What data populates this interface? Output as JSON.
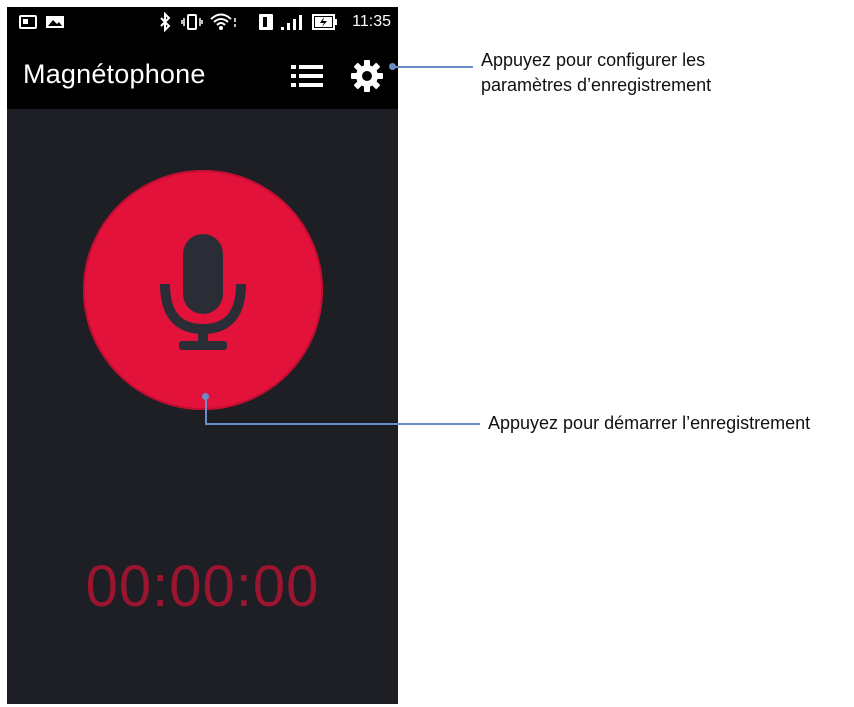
{
  "status_bar": {
    "time": "11:35",
    "icons": [
      "notification-icon",
      "image-icon",
      "bluetooth-icon",
      "vibrate-icon",
      "wifi-icon",
      "sim-icon",
      "signal-icon",
      "battery-charging-icon"
    ]
  },
  "app_bar": {
    "title": "Magnétophone",
    "icons": [
      "list-icon",
      "gear-icon"
    ]
  },
  "recorder": {
    "timer": "00:00:00",
    "record_icon": "microphone-icon"
  },
  "callouts": {
    "settings": {
      "line1": "Appuyez pour configurer les",
      "line2": "paramètres d’enregistrement"
    },
    "record": "Appuyez pour démarrer l’enregistrement"
  },
  "colors": {
    "accent": "#e2123a",
    "timer": "#9c1530",
    "background": "#1d1f24",
    "callout_line": "#6b8cc4"
  }
}
